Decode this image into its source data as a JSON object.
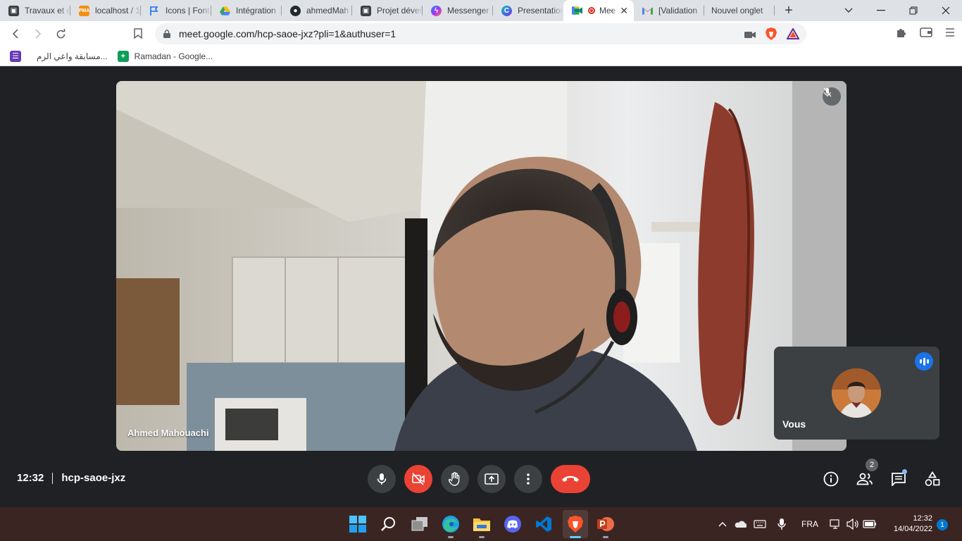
{
  "browser": {
    "tabs": [
      {
        "title": "Travaux et c",
        "icon": "classroom-icon",
        "color": "#3c4043"
      },
      {
        "title": "localhost / 1",
        "icon": "phpmyadmin-icon",
        "color": "#f29111"
      },
      {
        "title": "Icons | Font",
        "icon": "font-awesome-flag-icon",
        "color": "#1a73e8"
      },
      {
        "title": "Intégration",
        "icon": "google-drive-icon",
        "color": "#34a853"
      },
      {
        "title": "ahmedMah",
        "icon": "github-icon",
        "color": "#24292e"
      },
      {
        "title": "Projet dével",
        "icon": "classroom-icon",
        "color": "#3c4043"
      },
      {
        "title": "Messenger",
        "icon": "messenger-icon",
        "color": "#8a3ffc"
      },
      {
        "title": "Presentation",
        "icon": "canva-icon",
        "color": "#00c4cc"
      },
      {
        "title": "Meet",
        "icon": "google-meet-icon",
        "color": "#00897b"
      },
      {
        "title": "[Validation",
        "icon": "gmail-icon",
        "color": "#ea4335"
      },
      {
        "title": "Nouvel onglet",
        "icon": "",
        "color": ""
      }
    ],
    "new_tab_symbol": "+",
    "close_symbol": "✕",
    "url": "meet.google.com/hcp-saoe-jxz?pli=1&authuser=1",
    "bookmarks": [
      {
        "label": "مسابقة واعي الرم...",
        "color": "#673ab7"
      },
      {
        "label": "Ramadan - Google...",
        "color": "#0f9d58"
      }
    ]
  },
  "meet": {
    "speaker_name": "Ahmed Mahouachi",
    "self_label": "Vous",
    "time": "12:32",
    "meeting_code": "hcp-saoe-jxz",
    "participant_count": "2",
    "accent": "#1a73e8",
    "hangup_color": "#ea4335"
  },
  "taskbar": {
    "language": "FRA",
    "time": "12:32",
    "date": "14/04/2022",
    "notification_count": "1"
  }
}
